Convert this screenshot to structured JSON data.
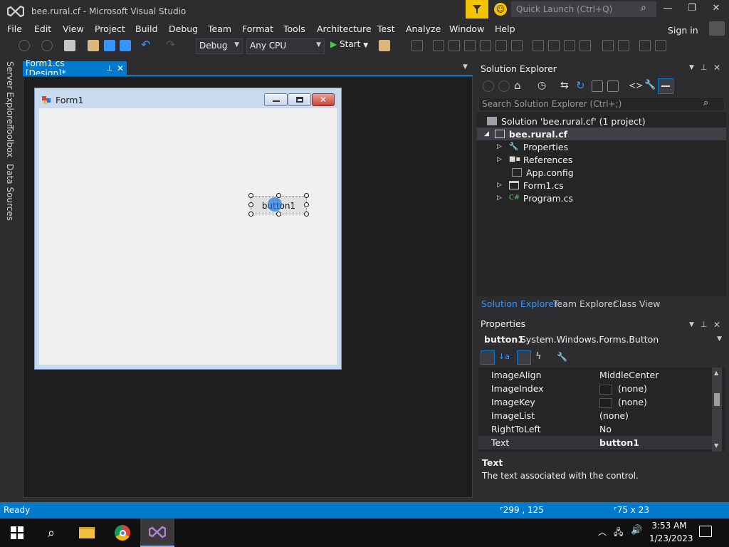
{
  "window": {
    "title": "bee.rural.cf - Microsoft Visual Studio"
  },
  "quick_launch": {
    "placeholder": "Quick Launch (Ctrl+Q)"
  },
  "menu": [
    "File",
    "Edit",
    "View",
    "Project",
    "Build",
    "Debug",
    "Team",
    "Format",
    "Tools",
    "Architecture",
    "Test",
    "Analyze",
    "Window",
    "Help"
  ],
  "signin": "Sign in",
  "toolbar": {
    "config": "Debug",
    "platform": "Any CPU",
    "start": "Start"
  },
  "side_tabs": [
    "Server Explorer",
    "Toolbox",
    "Data Sources"
  ],
  "doc_tab": {
    "label": "Form1.cs [Design]*"
  },
  "designer": {
    "form_title": "Form1",
    "button_text": "button1"
  },
  "solution_explorer": {
    "title": "Solution Explorer",
    "search_placeholder": "Search Solution Explorer (Ctrl+;)",
    "items": [
      {
        "label": "Solution 'bee.rural.cf' (1 project)",
        "icon": "solution-icon"
      },
      {
        "label": "bee.rural.cf",
        "icon": "csharp-project-icon"
      },
      {
        "label": "Properties",
        "icon": "wrench-icon"
      },
      {
        "label": "References",
        "icon": "references-icon"
      },
      {
        "label": "App.config",
        "icon": "config-file-icon"
      },
      {
        "label": "Form1.cs",
        "icon": "form-file-icon"
      },
      {
        "label": "Program.cs",
        "icon": "csharp-file-icon"
      }
    ],
    "tabs": [
      "Solution Explorer",
      "Team Explorer",
      "Class View"
    ]
  },
  "properties": {
    "title": "Properties",
    "object_name": "button1",
    "object_type": "System.Windows.Forms.Button",
    "rows": [
      {
        "name": "ImageAlign",
        "value": "MiddleCenter"
      },
      {
        "name": "ImageIndex",
        "value": "(none)"
      },
      {
        "name": "ImageKey",
        "value": "(none)"
      },
      {
        "name": "ImageList",
        "value": "(none)"
      },
      {
        "name": "RightToLeft",
        "value": "No"
      },
      {
        "name": "Text",
        "value": "button1"
      }
    ],
    "desc_title": "Text",
    "desc_text": "The text associated with the control."
  },
  "status": {
    "text": "Ready",
    "position": "299 , 125",
    "size": "75 x 23"
  },
  "taskbar": {
    "time": "3:53 AM",
    "date": "1/23/2023"
  },
  "colors": {
    "accent": "#007acc",
    "filter": "#f5c400",
    "bg": "#2d2d30"
  }
}
